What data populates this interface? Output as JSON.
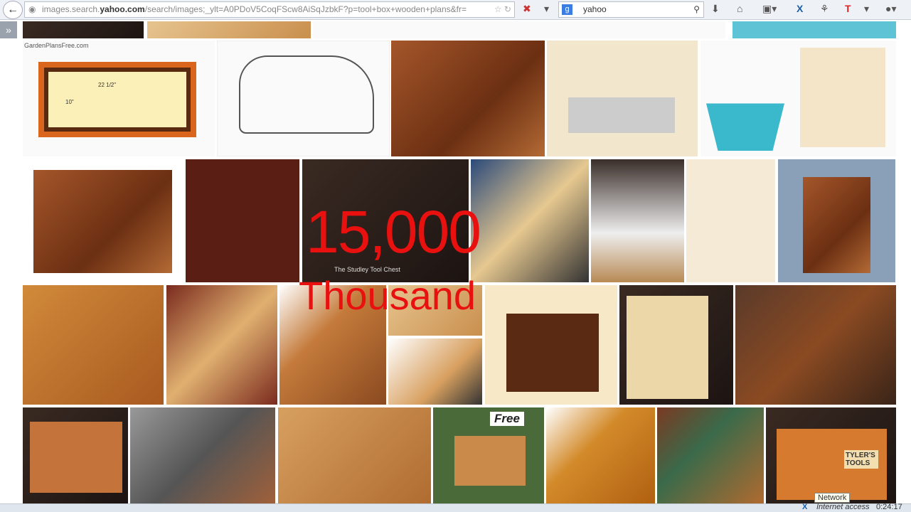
{
  "browser": {
    "url_prefix": "images.search.",
    "url_domain": "yahoo.com",
    "url_rest": "/search/images;_ylt=A0PDoV5CoqFScw8AiSqJzbkF?p=tool+box+wooden+plans&fr=",
    "search_value": "yahoo",
    "search_engine": "g"
  },
  "images": {
    "caption_garden": "GardenPlansFree.com",
    "caption_studley": "The Studley Tool Chest",
    "badge_free": "Free",
    "sign_tylers": "TYLER'S TOOLS",
    "dim_1": "22 1/2\"",
    "dim_2": "10\""
  },
  "overlay": {
    "number": "15,000",
    "unit": "Thousand"
  },
  "status": {
    "tooltip": "Network",
    "text": "Internet access",
    "clock": "0:24:17"
  }
}
